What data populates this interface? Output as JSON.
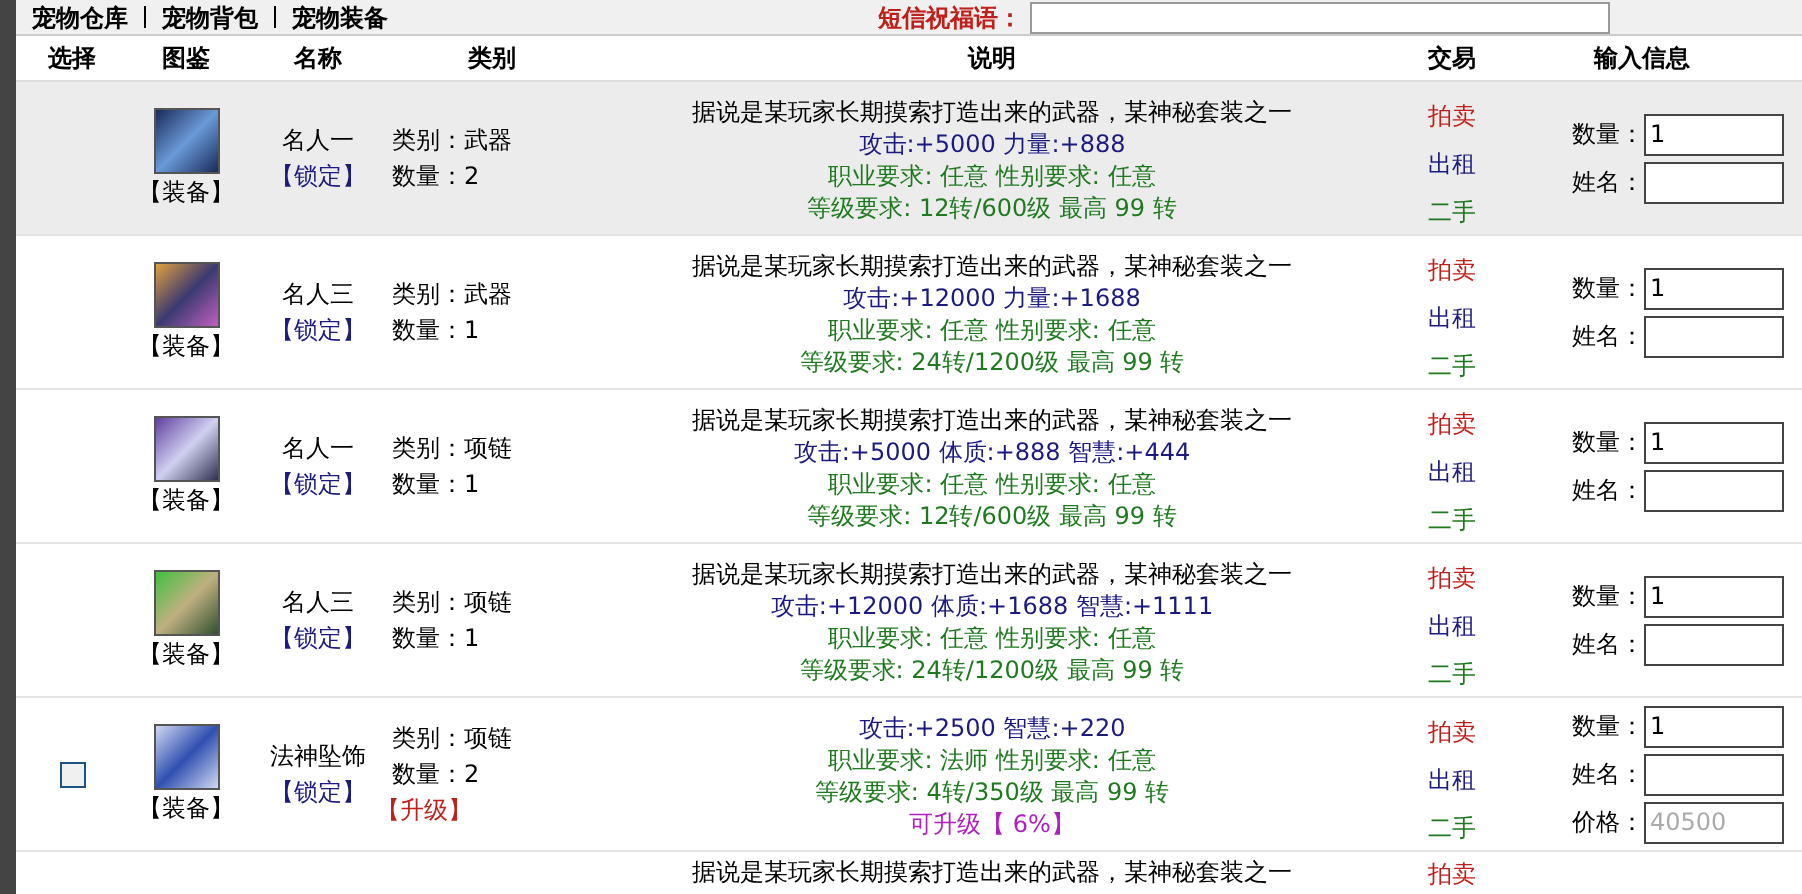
{
  "tabs": [
    "宠物仓库",
    "宠物背包",
    "宠物装备"
  ],
  "message": {
    "label": "短信祝福语："
  },
  "columns": [
    "选择",
    "图鉴",
    "名称",
    "类别",
    "说明",
    "交易",
    "输入信息"
  ],
  "rows": [
    {
      "highlighted": true,
      "equip": "【装备】",
      "name": "名人一",
      "lock": "【锁定】",
      "type": "类别：武器",
      "qty": "数量：2",
      "lines": [
        {
          "kind": "intro",
          "text": "据说是某玩家长期摸索打造出来的武器，某神秘套装之一"
        },
        {
          "kind": "stats",
          "text": "攻击:+5000 力量:+888"
        },
        {
          "kind": "req",
          "text": "职业要求: 任意 性别要求: 任意"
        },
        {
          "kind": "req",
          "text": "等级要求: 12转/600级 最高 99 转"
        }
      ],
      "trade": [
        {
          "kind": "auction",
          "text": "拍卖"
        },
        {
          "kind": "rent",
          "text": "出租"
        },
        {
          "kind": "used",
          "text": "二手"
        }
      ],
      "fields": [
        {
          "label": "数量：",
          "value": "1"
        },
        {
          "label": "姓名："
        }
      ]
    },
    {
      "highlighted": false,
      "equip": "【装备】",
      "name": "名人三",
      "lock": "【锁定】",
      "type": "类别：武器",
      "qty": "数量：1",
      "lines": [
        {
          "kind": "intro",
          "text": "据说是某玩家长期摸索打造出来的武器，某神秘套装之一"
        },
        {
          "kind": "stats",
          "text": "攻击:+12000 力量:+1688"
        },
        {
          "kind": "req",
          "text": "职业要求: 任意 性别要求: 任意"
        },
        {
          "kind": "req",
          "text": "等级要求: 24转/1200级 最高 99 转"
        }
      ],
      "trade": [
        {
          "kind": "auction",
          "text": "拍卖"
        },
        {
          "kind": "rent",
          "text": "出租"
        },
        {
          "kind": "used",
          "text": "二手"
        }
      ],
      "fields": [
        {
          "label": "数量：",
          "value": "1"
        },
        {
          "label": "姓名："
        }
      ]
    },
    {
      "highlighted": false,
      "equip": "【装备】",
      "name": "名人一",
      "lock": "【锁定】",
      "type": "类别：项链",
      "qty": "数量：1",
      "lines": [
        {
          "kind": "intro",
          "text": "据说是某玩家长期摸索打造出来的武器，某神秘套装之一"
        },
        {
          "kind": "stats",
          "text": "攻击:+5000 体质:+888 智慧:+444"
        },
        {
          "kind": "req",
          "text": "职业要求: 任意 性别要求: 任意"
        },
        {
          "kind": "req",
          "text": "等级要求: 12转/600级 最高 99 转"
        }
      ],
      "trade": [
        {
          "kind": "auction",
          "text": "拍卖"
        },
        {
          "kind": "rent",
          "text": "出租"
        },
        {
          "kind": "used",
          "text": "二手"
        }
      ],
      "fields": [
        {
          "label": "数量：",
          "value": "1"
        },
        {
          "label": "姓名："
        }
      ]
    },
    {
      "highlighted": false,
      "equip": "【装备】",
      "name": "名人三",
      "lock": "【锁定】",
      "type": "类别：项链",
      "qty": "数量：1",
      "lines": [
        {
          "kind": "intro",
          "text": "据说是某玩家长期摸索打造出来的武器，某神秘套装之一"
        },
        {
          "kind": "stats",
          "text": "攻击:+12000 体质:+1688 智慧:+1111"
        },
        {
          "kind": "req",
          "text": "职业要求: 任意 性别要求: 任意"
        },
        {
          "kind": "req",
          "text": "等级要求: 24转/1200级 最高 99 转"
        }
      ],
      "trade": [
        {
          "kind": "auction",
          "text": "拍卖"
        },
        {
          "kind": "rent",
          "text": "出租"
        },
        {
          "kind": "used",
          "text": "二手"
        }
      ],
      "fields": [
        {
          "label": "数量：",
          "value": "1"
        },
        {
          "label": "姓名："
        }
      ]
    },
    {
      "highlighted": false,
      "checked": false,
      "equip": "【装备】",
      "name": "法神坠饰",
      "lock": "【锁定】",
      "type": "类别：项链",
      "qty": "数量：2",
      "upgrade": "【升级】",
      "lines": [
        {
          "kind": "stats",
          "text": "攻击:+2500 智慧:+220"
        },
        {
          "kind": "req",
          "text": "职业要求: 法师 性别要求: 任意"
        },
        {
          "kind": "req",
          "text": "等级要求: 4转/350级 最高 99 转"
        },
        {
          "kind": "upgrade",
          "text": "可升级【 6%】"
        }
      ],
      "trade": [
        {
          "kind": "auction",
          "text": "拍卖"
        },
        {
          "kind": "rent",
          "text": "出租"
        },
        {
          "kind": "used",
          "text": "二手"
        }
      ],
      "fields": [
        {
          "label": "数量：",
          "value": "1"
        },
        {
          "label": "姓名："
        },
        {
          "label": "价格：",
          "placeholder": "40500"
        }
      ]
    },
    {
      "highlighted": false,
      "lines": [
        {
          "kind": "intro",
          "text": "据说是某玩家长期摸索打造出来的武器，某神秘套装之一"
        }
      ],
      "trade": [
        {
          "kind": "auction",
          "text": "拍卖"
        }
      ]
    }
  ]
}
